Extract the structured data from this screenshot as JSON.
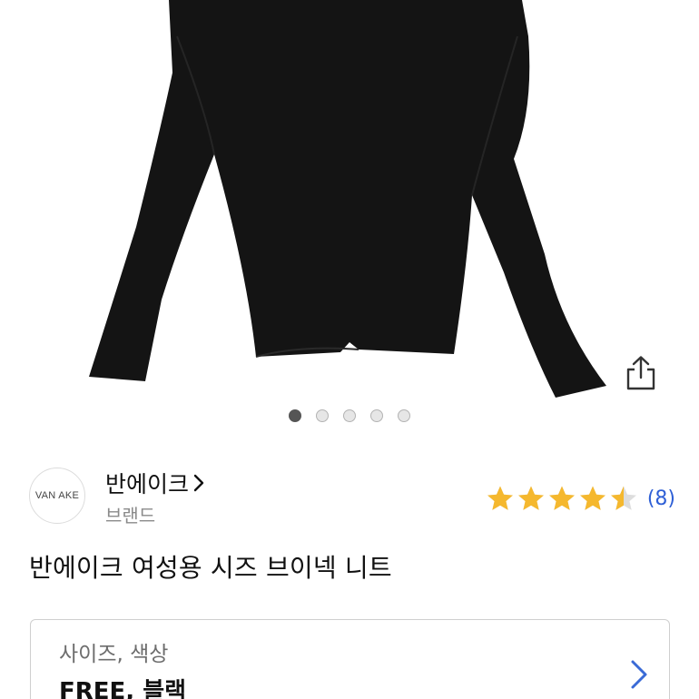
{
  "gallery": {
    "dot_count": 5,
    "active_index": 0
  },
  "brand": {
    "logo_text": "VAN AKE",
    "name": "반에이크",
    "subtitle": "브랜드"
  },
  "rating": {
    "stars": 4.5,
    "max_stars": 5,
    "count": "(8)",
    "star_color": "#f5b82e",
    "count_color": "#2e5fd6"
  },
  "product": {
    "title": "반에이크 여성용 시즈 브이넥 니트"
  },
  "options": {
    "label": "사이즈, 색상",
    "value": "FREE, 블랙"
  },
  "icons": {
    "share": "share-icon",
    "brand_chevron": "chevron-right-icon",
    "option_chevron": "chevron-right-icon"
  }
}
